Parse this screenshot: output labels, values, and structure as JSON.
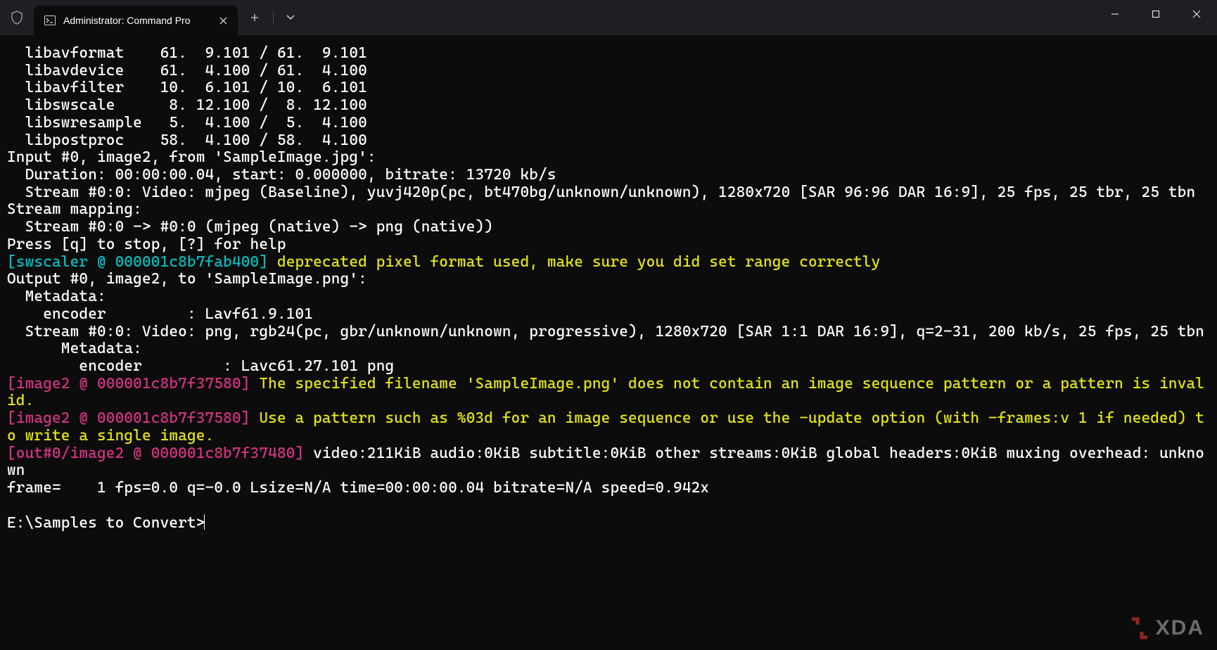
{
  "titlebar": {
    "tab_title": "Administrator: Command Pro"
  },
  "terminal": {
    "lines": [
      {
        "segs": [
          {
            "t": "  libavformat    61.  9.101 / 61.  9.101"
          }
        ]
      },
      {
        "segs": [
          {
            "t": "  libavdevice    61.  4.100 / 61.  4.100"
          }
        ]
      },
      {
        "segs": [
          {
            "t": "  libavfilter    10.  6.101 / 10.  6.101"
          }
        ]
      },
      {
        "segs": [
          {
            "t": "  libswscale      8. 12.100 /  8. 12.100"
          }
        ]
      },
      {
        "segs": [
          {
            "t": "  libswresample   5.  4.100 /  5.  4.100"
          }
        ]
      },
      {
        "segs": [
          {
            "t": "  libpostproc    58.  4.100 / 58.  4.100"
          }
        ]
      },
      {
        "segs": [
          {
            "t": "Input #0, image2, from 'SampleImage.jpg':"
          }
        ]
      },
      {
        "segs": [
          {
            "t": "  Duration: 00:00:00.04, start: 0.000000, bitrate: 13720 kb/s"
          }
        ]
      },
      {
        "segs": [
          {
            "t": "  Stream #0:0: Video: mjpeg (Baseline), yuvj420p(pc, bt470bg/unknown/unknown), 1280x720 [SAR 96:96 DAR 16:9], 25 fps, 25 tbr, 25 tbn"
          }
        ]
      },
      {
        "segs": [
          {
            "t": "Stream mapping:"
          }
        ]
      },
      {
        "segs": [
          {
            "t": "  Stream #0:0 -> #0:0 (mjpeg (native) -> png (native))"
          }
        ]
      },
      {
        "segs": [
          {
            "t": "Press [q] to stop, [?] for help"
          }
        ]
      },
      {
        "segs": [
          {
            "t": "[swscaler @ 000001c8b7fab400] ",
            "c": "cyan"
          },
          {
            "t": "deprecated pixel format used, make sure you did set range correctly",
            "c": "yellow"
          }
        ]
      },
      {
        "segs": [
          {
            "t": "Output #0, image2, to 'SampleImage.png':"
          }
        ]
      },
      {
        "segs": [
          {
            "t": "  Metadata:"
          }
        ]
      },
      {
        "segs": [
          {
            "t": "    encoder         : Lavf61.9.101"
          }
        ]
      },
      {
        "segs": [
          {
            "t": "  Stream #0:0: Video: png, rgb24(pc, gbr/unknown/unknown, progressive), 1280x720 [SAR 1:1 DAR 16:9], q=2-31, 200 kb/s, 25 fps, 25 tbn"
          }
        ]
      },
      {
        "segs": [
          {
            "t": "      Metadata:"
          }
        ]
      },
      {
        "segs": [
          {
            "t": "        encoder         : Lavc61.27.101 png"
          }
        ]
      },
      {
        "segs": [
          {
            "t": "[image2 @ 000001c8b7f37580] ",
            "c": "magenta"
          },
          {
            "t": "The specified filename 'SampleImage.png' does not contain an image sequence pattern or a pattern is invalid.",
            "c": "yellow"
          }
        ]
      },
      {
        "segs": [
          {
            "t": "[image2 @ 000001c8b7f37580] ",
            "c": "magenta"
          },
          {
            "t": "Use a pattern such as %03d for an image sequence or use the -update option (with -frames:v 1 if needed) to write a single image.",
            "c": "yellow"
          }
        ]
      },
      {
        "segs": [
          {
            "t": "[out#0/image2 @ 000001c8b7f37480] ",
            "c": "magenta"
          },
          {
            "t": "video:211KiB audio:0KiB subtitle:0KiB other streams:0KiB global headers:0KiB muxing overhead: unknown"
          }
        ]
      },
      {
        "segs": [
          {
            "t": "frame=    1 fps=0.0 q=-0.0 Lsize=N/A time=00:00:00.04 bitrate=N/A speed=0.942x"
          }
        ]
      },
      {
        "segs": [
          {
            "t": ""
          }
        ]
      }
    ],
    "prompt": "E:\\Samples to Convert>"
  },
  "watermark": {
    "text": "XDA"
  }
}
